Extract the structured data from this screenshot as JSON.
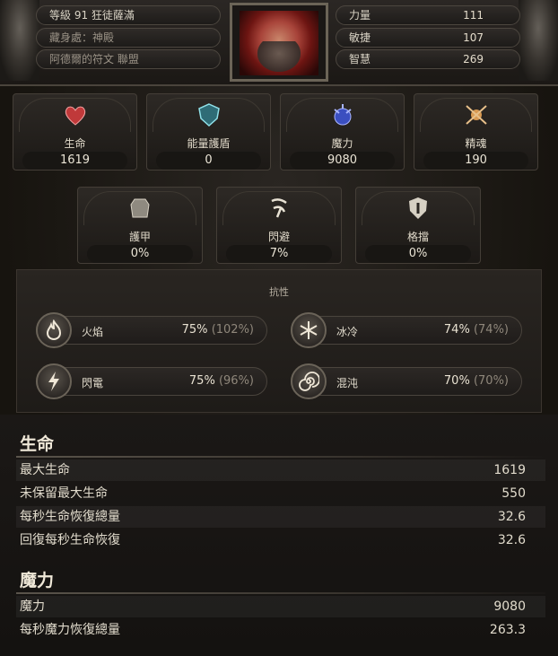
{
  "header": {
    "level_class": "等級 91 狂徒薩滿",
    "hideout": "藏身處：神殿",
    "league": "阿德爾的符文 聯盟",
    "attributes": [
      {
        "label": "力量",
        "value": "111"
      },
      {
        "label": "敏捷",
        "value": "107"
      },
      {
        "label": "智慧",
        "value": "269"
      }
    ]
  },
  "primary_stats": [
    {
      "label": "生命",
      "value": "1619",
      "icon": "heart-icon",
      "color": "#c0393a"
    },
    {
      "label": "能量護盾",
      "value": "0",
      "icon": "energy-shield-icon",
      "color": "#6fc1c9"
    },
    {
      "label": "魔力",
      "value": "9080",
      "icon": "mana-icon",
      "color": "#4d63d8"
    },
    {
      "label": "精魂",
      "value": "190",
      "icon": "spirit-icon",
      "color": "#d99a52"
    }
  ],
  "defence_stats": [
    {
      "label": "護甲",
      "value": "0%",
      "icon": "armour-icon"
    },
    {
      "label": "閃避",
      "value": "7%",
      "icon": "evasion-icon"
    },
    {
      "label": "格擋",
      "value": "0%",
      "icon": "block-icon"
    }
  ],
  "resistances": {
    "title": "抗性",
    "items": [
      {
        "label": "火焰",
        "value": "75%",
        "max": "(102%)",
        "icon": "fire-icon"
      },
      {
        "label": "冰冷",
        "value": "74%",
        "max": "(74%)",
        "icon": "cold-icon"
      },
      {
        "label": "閃電",
        "value": "75%",
        "max": "(96%)",
        "icon": "lightning-icon"
      },
      {
        "label": "混沌",
        "value": "70%",
        "max": "(70%)",
        "icon": "chaos-icon"
      }
    ]
  },
  "life_section": {
    "title": "生命",
    "rows": [
      {
        "label": "最大生命",
        "value": "1619"
      },
      {
        "label": "未保留最大生命",
        "value": "550"
      },
      {
        "label": "每秒生命恢復總量",
        "value": "32.6"
      },
      {
        "label": "回復每秒生命恢復",
        "value": "32.6"
      }
    ]
  },
  "mana_section": {
    "title": "魔力",
    "rows": [
      {
        "label": "魔力",
        "value": "9080"
      },
      {
        "label": "每秒魔力恢復總量",
        "value": "263.3"
      }
    ]
  }
}
